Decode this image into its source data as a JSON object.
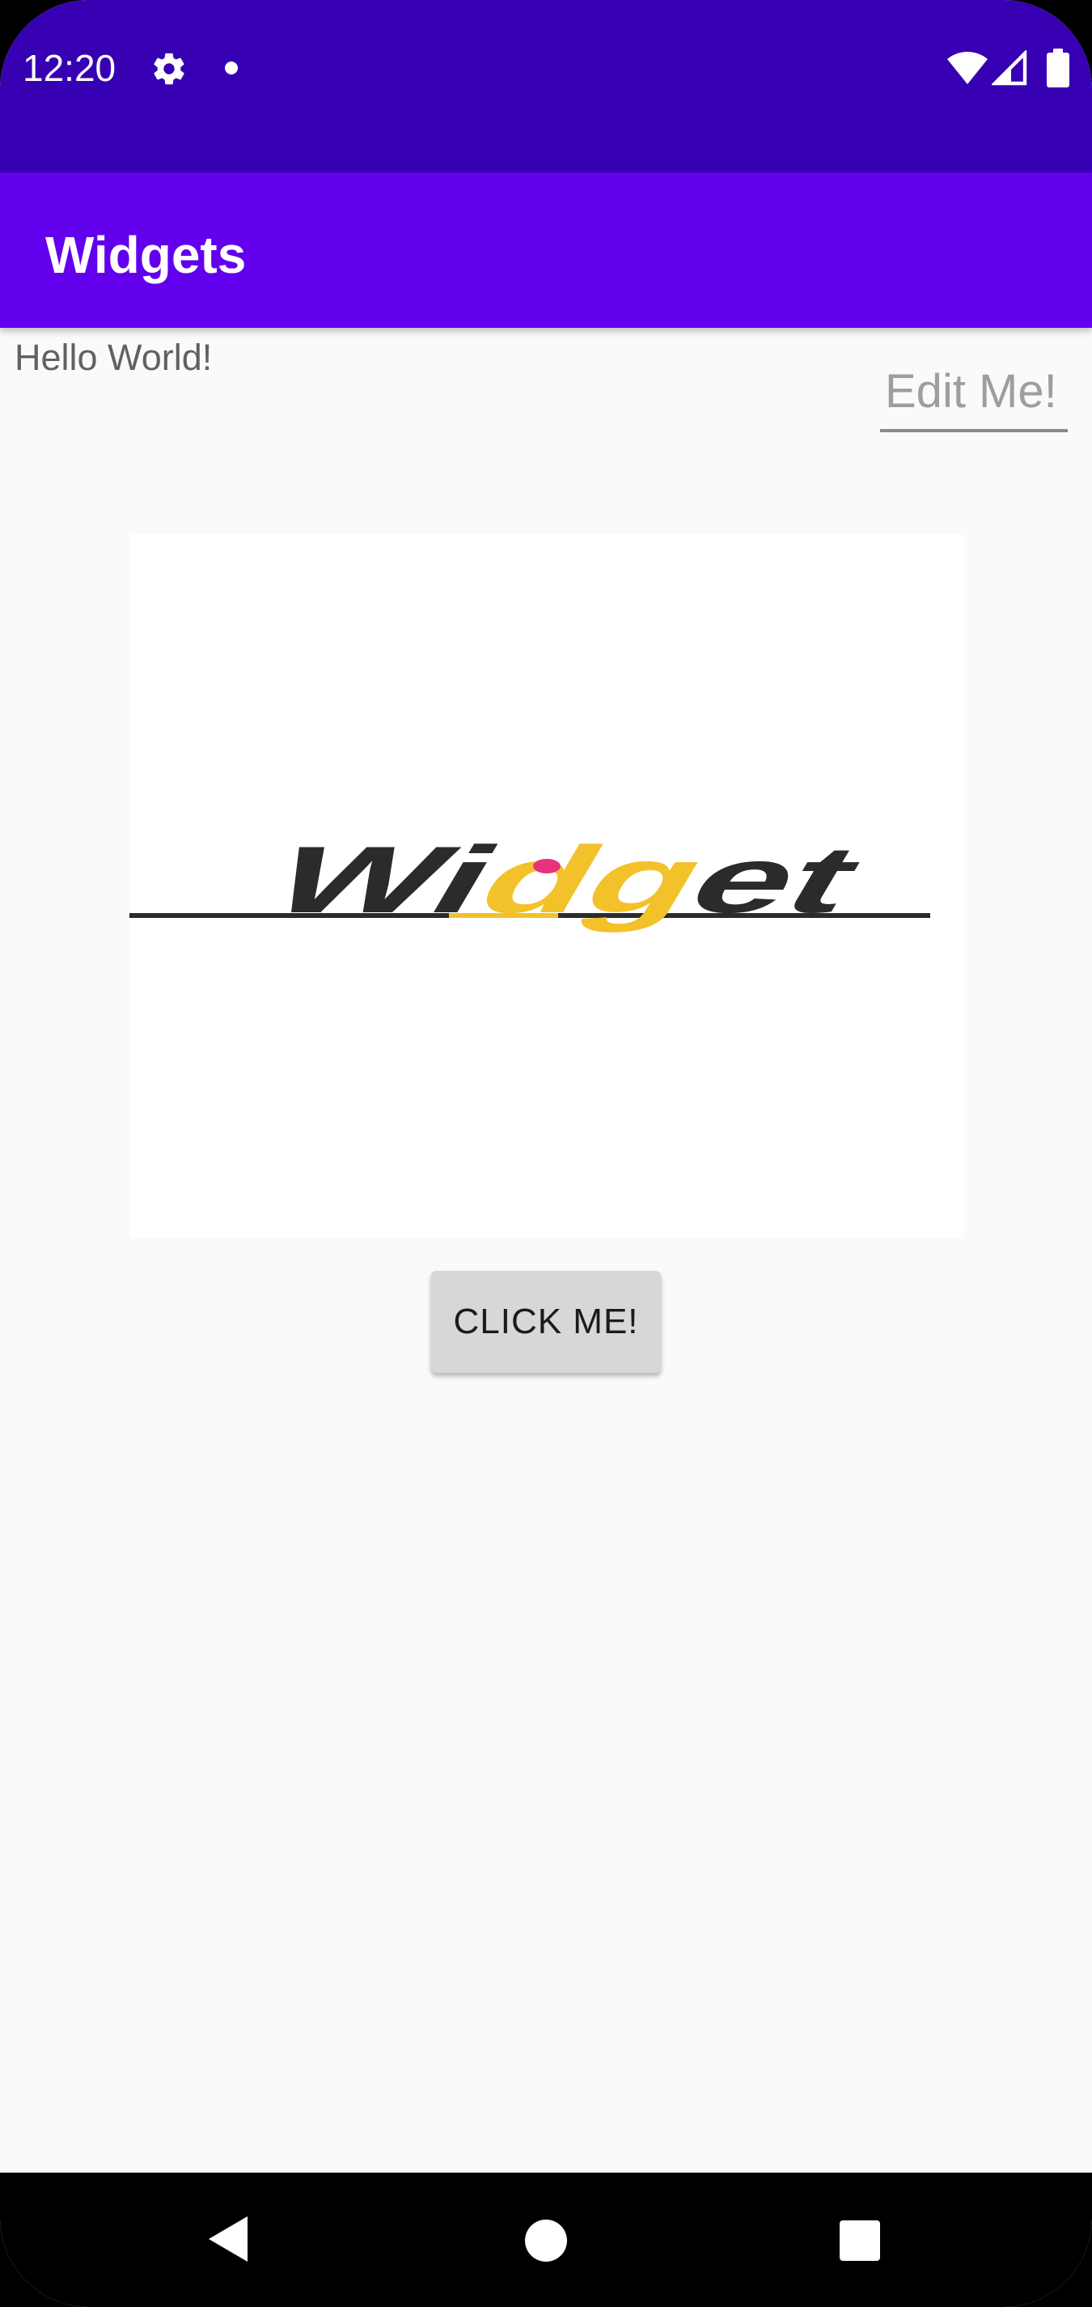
{
  "status_bar": {
    "time": "12:20",
    "icons": [
      "gear-icon",
      "notification-dot-icon",
      "wifi-icon",
      "cell-signal-icon",
      "battery-icon"
    ]
  },
  "app_bar": {
    "title": "Widgets"
  },
  "content": {
    "hello_text": "Hello World!",
    "edit_field": {
      "placeholder": "Edit Me!",
      "value": ""
    },
    "logo": {
      "text": "Widget",
      "colors": {
        "dark": "#2b2b2b",
        "accent": "#f3c12a",
        "highlight": "#e8327c"
      }
    },
    "button_label": "CLICK ME!"
  },
  "nav_bar": {
    "icons": [
      "back-icon",
      "home-icon",
      "recents-icon"
    ]
  },
  "colors": {
    "status_bar": "#3700b3",
    "app_bar": "#6200ee",
    "background": "#fafafa",
    "button": "#d6d7d7"
  }
}
